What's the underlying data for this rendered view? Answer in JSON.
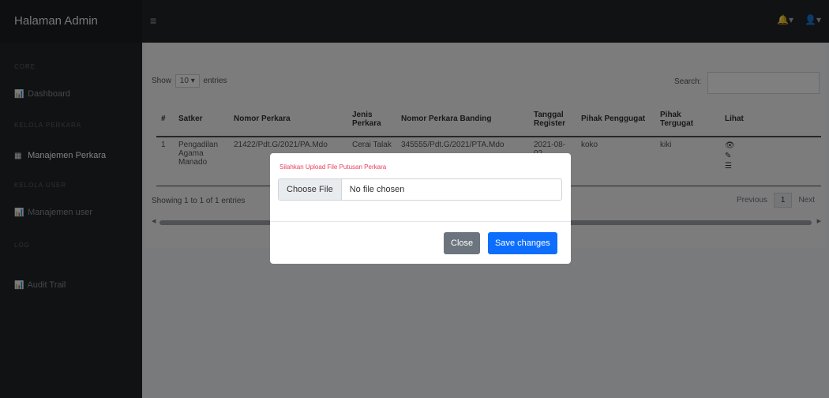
{
  "brand": "Halaman Admin",
  "colors": {
    "topbar": "#212529",
    "sidebar": "#212529",
    "primary": "#0d6efd",
    "secondary": "#6c757d",
    "message": "#e83e5c"
  },
  "topbar": {
    "menu_icon": "hamburger-icon",
    "notif_icon": "bell-icon",
    "user_icon": "user-icon"
  },
  "sidebar": {
    "headings": [
      "Core",
      "Kelola Perkara",
      "Kelola User",
      "Log"
    ],
    "items": [
      {
        "label": "Dashboard",
        "icon": "chart-icon"
      },
      {
        "label": "Manajemen Perkara",
        "icon": "table-icon",
        "active": true
      },
      {
        "label": "Manajemen user",
        "icon": "chart-icon"
      },
      {
        "label": "Audit Trail",
        "icon": "chart-icon"
      }
    ]
  },
  "table_controls": {
    "show_label": "Show",
    "length_value": "10",
    "entries_label": "entries",
    "search_label": "Search:"
  },
  "table": {
    "headers": [
      "#",
      "Satker",
      "Nomor Perkara",
      "Jenis Perkara",
      "Nomor Perkara Banding",
      "Tanggal Register",
      "Pihak Penggugat",
      "Pihak Tergugat",
      "Lihat"
    ],
    "rows": [
      [
        "1",
        "Pengadilan Agama Manado",
        "21422/Pdt.G/2021/PA.Mdo",
        "Cerai Talak",
        "345555/Pdt.G/2021/PTA.Mdo",
        "2021-08-02",
        "koko",
        "kiki"
      ]
    ]
  },
  "info": "Showing 1 to 1 of 1 entries",
  "pagination": {
    "previous": "Previous",
    "current": "1",
    "next": "Next"
  },
  "modal": {
    "message": "Silahkan Upload File Putusan Perkara",
    "choose_file": "Choose File",
    "no_file": "No file chosen",
    "close": "Close",
    "save": "Save changes"
  }
}
